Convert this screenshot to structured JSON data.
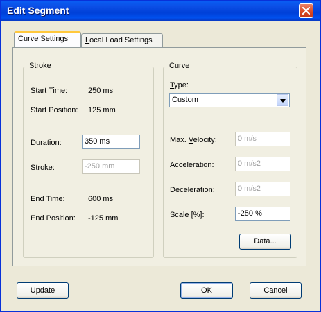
{
  "window": {
    "title": "Edit Segment"
  },
  "tabs": [
    {
      "label_pre": "",
      "label_key": "C",
      "label_post": "urve Settings",
      "active": true
    },
    {
      "label_pre": "",
      "label_key": "L",
      "label_post": "ocal Load Settings",
      "active": false
    }
  ],
  "stroke_group": {
    "title": "Stroke",
    "start_time_label": "Start Time:",
    "start_time_value": "250 ms",
    "start_position_label": "Start Position:",
    "start_position_value": "125 mm",
    "duration_label_pre": "Du",
    "duration_label_key": "r",
    "duration_label_post": "ation:",
    "duration_value": "350 ms",
    "stroke_label_key": "S",
    "stroke_label_post": "troke:",
    "stroke_value": "-250 mm",
    "end_time_label": "End Time:",
    "end_time_value": "600 ms",
    "end_position_label": "End Position:",
    "end_position_value": "-125 mm"
  },
  "curve_group": {
    "title": "Curve",
    "type_label_key": "T",
    "type_label_post": "ype:",
    "type_value": "Custom",
    "max_velocity_label_pre": "Max. ",
    "max_velocity_label_key": "V",
    "max_velocity_label_post": "elocity:",
    "max_velocity_value": "0 m/s",
    "acceleration_label_key": "A",
    "acceleration_label_post": "cceleration:",
    "acceleration_value": "0 m/s2",
    "deceleration_label_key": "D",
    "deceleration_label_post": "eceleration:",
    "deceleration_value": "0 m/s2",
    "scale_label": "Scale [%]:",
    "scale_value": "-250 %",
    "data_button": "Data..."
  },
  "buttons": {
    "update": "Update",
    "ok": "OK",
    "cancel": "Cancel"
  },
  "icons": {
    "close": "close-icon",
    "dropdown": "chevron-down-icon"
  },
  "colors": {
    "titlebar": "#0050ee",
    "close_button": "#d9471f",
    "tab_highlight": "#ffc83c",
    "dialog_bg": "#ece9d8"
  }
}
